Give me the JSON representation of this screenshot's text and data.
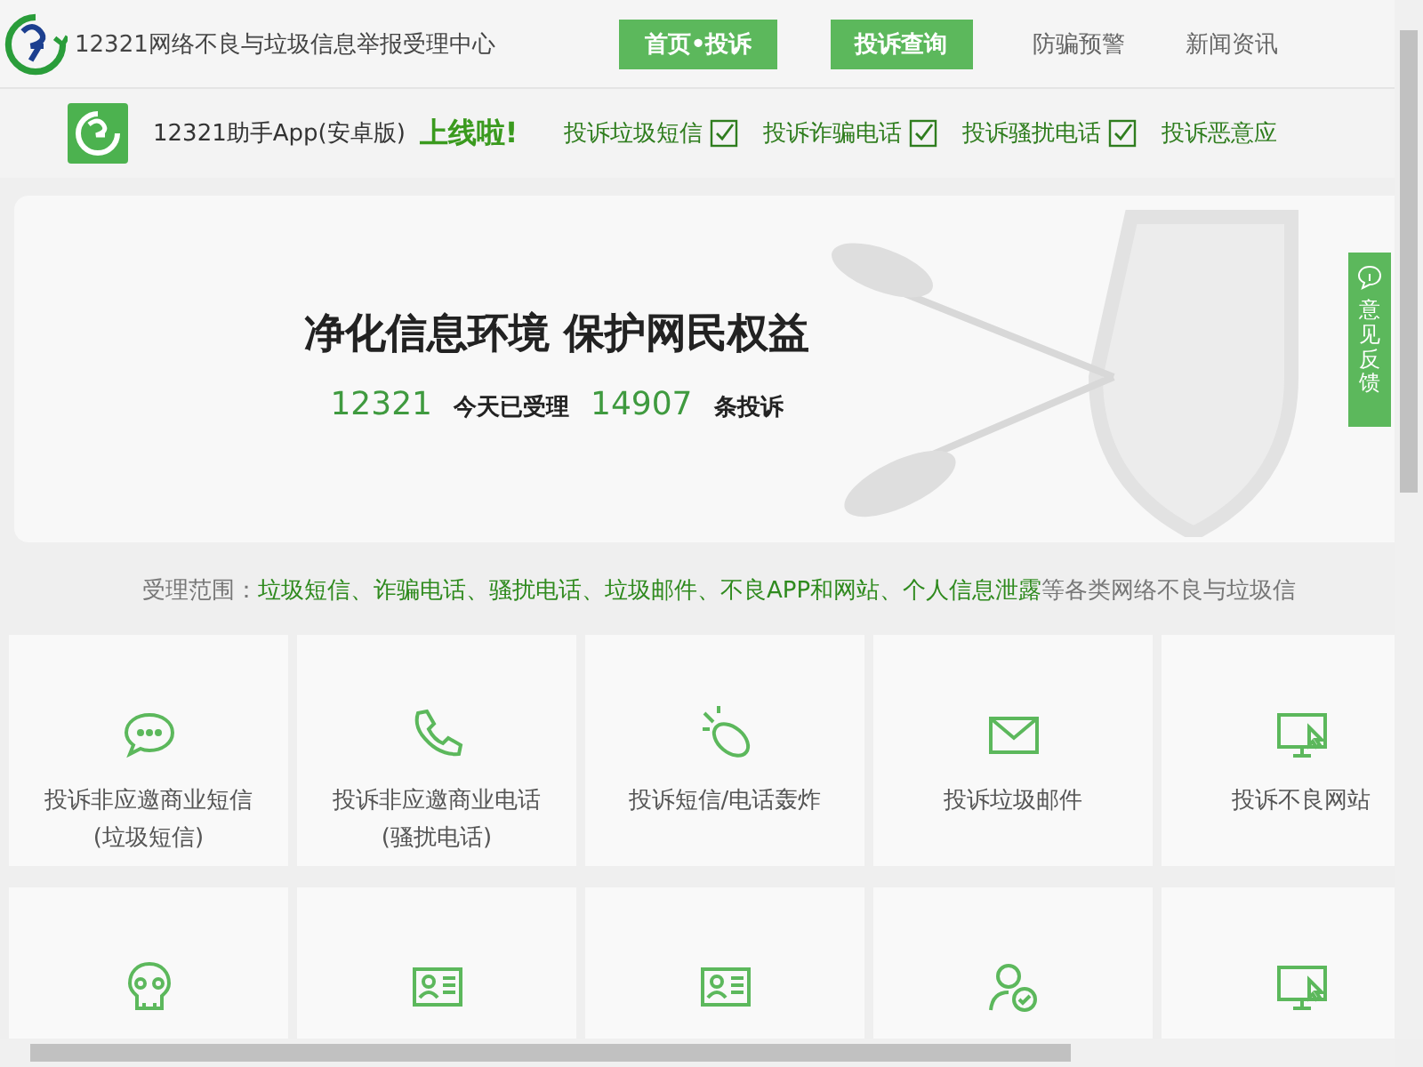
{
  "header": {
    "site_title": "12321网络不良与垃圾信息举报受理中心",
    "nav": [
      {
        "label": "首页•投诉",
        "kind": "button"
      },
      {
        "label": "投诉查询",
        "kind": "button"
      },
      {
        "label": "防骗预警",
        "kind": "link"
      },
      {
        "label": "新闻资讯",
        "kind": "link"
      }
    ]
  },
  "app_bar": {
    "app_name": "12321助手App(安卓版)",
    "slogan": "上线啦!",
    "features": [
      {
        "label": "投诉垃圾短信",
        "checked": true
      },
      {
        "label": "投诉诈骗电话",
        "checked": true
      },
      {
        "label": "投诉骚扰电话",
        "checked": true
      },
      {
        "label": "投诉恶意应"
      }
    ]
  },
  "banner": {
    "headline": "净化信息环境 保护网民权益",
    "hotline": "12321",
    "today_label": "今天已受理",
    "count": "14907",
    "count_unit": "条投诉"
  },
  "feedback_tab": {
    "label": "意见反馈"
  },
  "scope": {
    "label": "受理范围：",
    "items": "垃圾短信、诈骗电话、骚扰电话、垃圾邮件、不良APP和网站、个人信息泄露",
    "tail": "等各类网络不良与垃圾信"
  },
  "tiles": [
    {
      "kind": "chat",
      "lines": [
        "投诉非应邀商业短信",
        "(垃圾短信)"
      ]
    },
    {
      "kind": "phone",
      "lines": [
        "投诉非应邀商业电话",
        "(骚扰电话)"
      ]
    },
    {
      "kind": "bomb",
      "lines": [
        "投诉短信/电话轰炸"
      ]
    },
    {
      "kind": "mail",
      "lines": [
        "投诉垃圾邮件"
      ]
    },
    {
      "kind": "monitor",
      "lines": [
        "投诉不良网站"
      ]
    },
    {
      "kind": "skull"
    },
    {
      "kind": "idcard"
    },
    {
      "kind": "idcard"
    },
    {
      "kind": "usercheck"
    },
    {
      "kind": "monitor"
    }
  ]
}
